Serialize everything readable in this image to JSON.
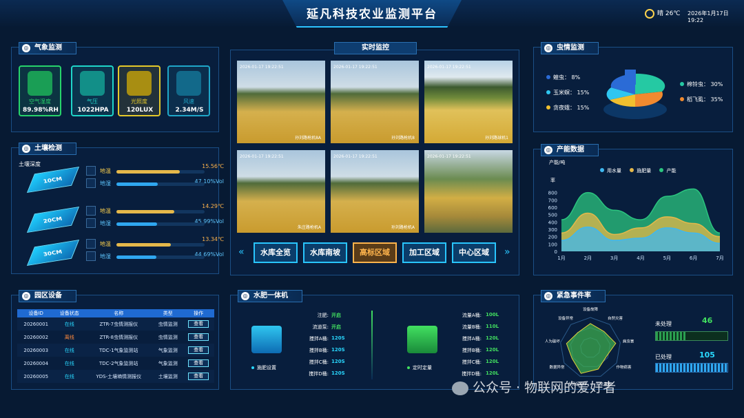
{
  "header": {
    "title": "延凡科技农业监测平台",
    "weather": "晴 26℃",
    "datetime": "2026年1月17日 19:22"
  },
  "weather_panel": {
    "title": "气象监测",
    "items": [
      {
        "label": "空气湿度",
        "value": "89.98%RH",
        "color": "#27d36b"
      },
      {
        "label": "气压",
        "value": "1022HPA",
        "color": "#1fd6c9"
      },
      {
        "label": "光照度",
        "value": "120LUX",
        "color": "#e5c92a"
      },
      {
        "label": "风速",
        "value": "2.34M/S",
        "color": "#1fa7c9"
      }
    ]
  },
  "soil_panel": {
    "title": "土壤检测",
    "subtitle": "土壤深度",
    "layers": [
      {
        "depth": "10CM",
        "temp_label": "地温",
        "temp": "15.56℃",
        "temp_pct": 0.72,
        "hum_label": "地湿",
        "hum": "47.10%Vol",
        "hum_pct": 0.47
      },
      {
        "depth": "20CM",
        "temp_label": "地温",
        "temp": "14.29℃",
        "temp_pct": 0.66,
        "hum_label": "地湿",
        "hum": "45.99%Vol",
        "hum_pct": 0.46
      },
      {
        "depth": "30CM",
        "temp_label": "地温",
        "temp": "13.34℃",
        "temp_pct": 0.62,
        "hum_label": "地湿",
        "hum": "44.69%Vol",
        "hum_pct": 0.45
      }
    ]
  },
  "video_panel": {
    "title": "实时监控",
    "cameras": [
      {
        "ts": "2026-01-17 19:22:51",
        "name": "孙刘路枪机8A"
      },
      {
        "ts": "2026-01-17 19:22:51",
        "name": "孙刘路枪机8"
      },
      {
        "ts": "2026-01-17 19:22:51",
        "name": "孙刘路球机1"
      },
      {
        "ts": "2026-01-17 19:22:51",
        "name": "朱庄路枪机A"
      },
      {
        "ts": "2026-01-17 19:22:51",
        "name": "孙刘路枪机A"
      },
      {
        "ts": "2026-01-17 19:22:51",
        "name": ""
      }
    ],
    "zones": [
      "水库全览",
      "水库南坡",
      "高标区域",
      "加工区域",
      "中心区域"
    ],
    "active_zone": 2
  },
  "pest_panel": {
    "title": "虫情监测",
    "items": [
      {
        "label": "蝗虫",
        "value": "8%",
        "color": "#2b6bd6"
      },
      {
        "label": "玉米螟",
        "value": "15%",
        "color": "#2fc6f0"
      },
      {
        "label": "贪夜蛾",
        "value": "15%",
        "color": "#f0c02f"
      },
      {
        "label": "棉铃虫",
        "value": "30%",
        "color": "#25c9a3"
      },
      {
        "label": "稻飞虱",
        "value": "35%",
        "color": "#f08a2f"
      }
    ]
  },
  "production_panel": {
    "title": "产能数据",
    "unit_label": "产能/吨",
    "y_axis_title": "率",
    "chart_data": {
      "type": "area",
      "categories": [
        "1月",
        "2月",
        "3月",
        "4月",
        "5月",
        "6月",
        "7月"
      ],
      "ylim": [
        0,
        900
      ],
      "yticks": [
        0,
        100,
        200,
        300,
        400,
        500,
        600,
        700,
        800
      ],
      "series": [
        {
          "name": "用水量",
          "color": "#3fb8f0",
          "values": [
            150,
            330,
            150,
            180,
            320,
            250,
            110
          ]
        },
        {
          "name": "施肥量",
          "color": "#e5b84a",
          "values": [
            250,
            520,
            230,
            320,
            470,
            380,
            200
          ]
        },
        {
          "name": "产能",
          "color": "#2bc57f",
          "values": [
            430,
            800,
            560,
            430,
            750,
            850,
            250
          ]
        }
      ],
      "legend_position": "top"
    }
  },
  "device_panel": {
    "title": "园区设备",
    "columns": [
      "设备ID",
      "设备状态",
      "名称",
      "类型",
      "操作"
    ],
    "rows": [
      {
        "id": "20260001",
        "status": "在线",
        "status_color": "#29d8ff",
        "name": "ZTR-7虫情测报仪",
        "type": "虫情监测",
        "op": "查看"
      },
      {
        "id": "20260002",
        "status": "离线",
        "status_color": "#ff8a3c",
        "name": "ZTR-8虫情测报仪",
        "type": "虫情监测",
        "op": "查看"
      },
      {
        "id": "20260003",
        "status": "在线",
        "status_color": "#29d8ff",
        "name": "TDC-1气象监测站",
        "type": "气象监测",
        "op": "查看"
      },
      {
        "id": "20260004",
        "status": "在线",
        "status_color": "#29d8ff",
        "name": "TDC-2气象监测站",
        "type": "气象监测",
        "op": "查看"
      },
      {
        "id": "20260005",
        "status": "在线",
        "status_color": "#29d8ff",
        "name": "YDS-土壤墒情测报仪",
        "type": "土壤监测",
        "op": "查看"
      }
    ]
  },
  "waterfert_panel": {
    "title": "水肥一体机",
    "left_caption": "施肥设置",
    "right_caption": "定时定量",
    "controls": [
      {
        "label": "注肥:",
        "value": "开启"
      },
      {
        "label": "流道泵:",
        "value": "开启"
      },
      {
        "label": "搅拌A桶:",
        "value": "120S"
      },
      {
        "label": "搅拌B桶:",
        "value": "120S"
      },
      {
        "label": "搅拌C桶:",
        "value": "120S"
      },
      {
        "label": "搅拌D桶:",
        "value": "120S"
      }
    ],
    "flows": [
      {
        "label": "流量A桶:",
        "value": "100L"
      },
      {
        "label": "流量B桶:",
        "value": "110L"
      },
      {
        "label": "搅拌A桶:",
        "value": "120L"
      },
      {
        "label": "搅拌B桶:",
        "value": "120L"
      },
      {
        "label": "搅拌C桶:",
        "value": "120L"
      },
      {
        "label": "搅拌D桶:",
        "value": "120L"
      }
    ]
  },
  "event_panel": {
    "title": "紧急事件率",
    "radar_labels": [
      "设备故障",
      "自然灾害",
      "病虫害",
      "作物病害",
      "安全事故",
      "人员误操作",
      "数据异常",
      "人为破坏",
      "设备异常"
    ],
    "unprocessed_label": "未处理",
    "unprocessed": "46",
    "unprocessed_pct": 0.43,
    "processed_label": "已处理",
    "processed": "105",
    "processed_pct": 0.98
  },
  "watermark": "公众号 · 物联网的爱好者"
}
